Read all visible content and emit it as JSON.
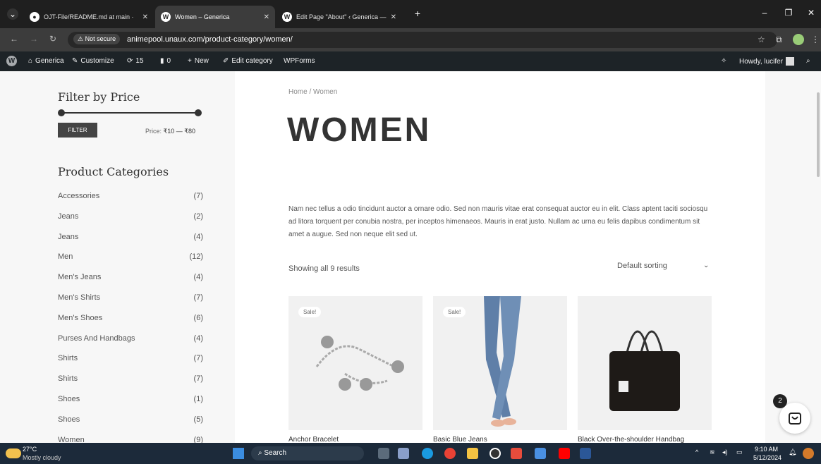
{
  "browser": {
    "tabs": [
      {
        "title": "OJT-File/README.md at main ·"
      },
      {
        "title": "Women – Generica"
      },
      {
        "title": "Edit Page \"About\" ‹ Generica —"
      }
    ],
    "not_secure": "Not secure",
    "url": "animepool.unaux.com/product-category/women/"
  },
  "wp": {
    "site": "Generica",
    "customize": "Customize",
    "updates": "15",
    "comments": "0",
    "new": "New",
    "edit": "Edit category",
    "forms": "WPForms",
    "howdy": "Howdy, lucifer"
  },
  "sidebar": {
    "filter_title": "Filter by Price",
    "filter_btn": "FILTER",
    "price_label": "Price:",
    "price_range": "₹10 — ₹80",
    "cat_title": "Product Categories",
    "categories": [
      {
        "name": "Accessories",
        "count": "(7)"
      },
      {
        "name": "Jeans",
        "count": "(2)"
      },
      {
        "name": "Jeans",
        "count": "(4)"
      },
      {
        "name": "Men",
        "count": "(12)"
      },
      {
        "name": "Men's Jeans",
        "count": "(4)"
      },
      {
        "name": "Men's Shirts",
        "count": "(7)"
      },
      {
        "name": "Men's Shoes",
        "count": "(6)"
      },
      {
        "name": "Purses And Handbags",
        "count": "(4)"
      },
      {
        "name": "Shirts",
        "count": "(7)"
      },
      {
        "name": "Shirts",
        "count": "(7)"
      },
      {
        "name": "Shoes",
        "count": "(1)"
      },
      {
        "name": "Shoes",
        "count": "(5)"
      },
      {
        "name": "Women",
        "count": "(9)"
      }
    ]
  },
  "main": {
    "breadcrumb": "Home / Women",
    "title": "WOMEN",
    "description": "Nam nec tellus a odio tincidunt auctor a ornare odio. Sed non mauris vitae erat consequat auctor eu in elit. Class aptent taciti sociosqu ad litora torquent per conubia nostra, per inceptos himenaeos. Mauris in erat justo. Nullam ac urna eu felis dapibus condimentum sit amet a augue. Sed non neque elit sed ut.",
    "showing": "Showing all 9 results",
    "sorting": "Default sorting",
    "products": [
      {
        "title": "Anchor Bracelet",
        "sale": "Sale!"
      },
      {
        "title": "Basic Blue Jeans",
        "sale": "Sale!"
      },
      {
        "title": "Black Over-the-shoulder Handbag",
        "sale": ""
      }
    ],
    "cart_count": "2"
  },
  "taskbar": {
    "temp": "27°C",
    "weather": "Mostly cloudy",
    "search": "Search",
    "time": "9:10 AM",
    "date": "5/12/2024"
  }
}
